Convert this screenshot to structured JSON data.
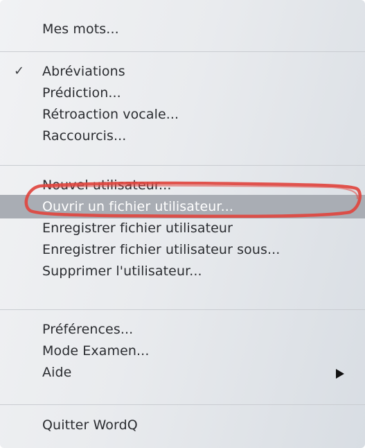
{
  "menu": {
    "items": [
      {
        "label": "Mes mots..."
      },
      {
        "label": "Abréviations",
        "checked": true,
        "check_icon": "checkmark-icon"
      },
      {
        "label": "Prédiction..."
      },
      {
        "label": "Rétroaction vocale..."
      },
      {
        "label": "Raccourcis..."
      },
      {
        "label": "Nouvel utilisateur..."
      },
      {
        "label": "Ouvrir un fichier utilisateur...",
        "highlighted": true
      },
      {
        "label": "Enregistrer fichier utilisateur"
      },
      {
        "label": "Enregistrer fichier utilisateur sous..."
      },
      {
        "label": "Supprimer l'utilisateur..."
      },
      {
        "label": "Préférences..."
      },
      {
        "label": "Mode Examen..."
      },
      {
        "label": "Aide",
        "submenu_icon": "submenu-arrow-icon"
      },
      {
        "label": "Quitter WordQ"
      }
    ]
  },
  "colors": {
    "highlight_bg": "#a9adb4",
    "annotation_red": "#e0453f"
  }
}
